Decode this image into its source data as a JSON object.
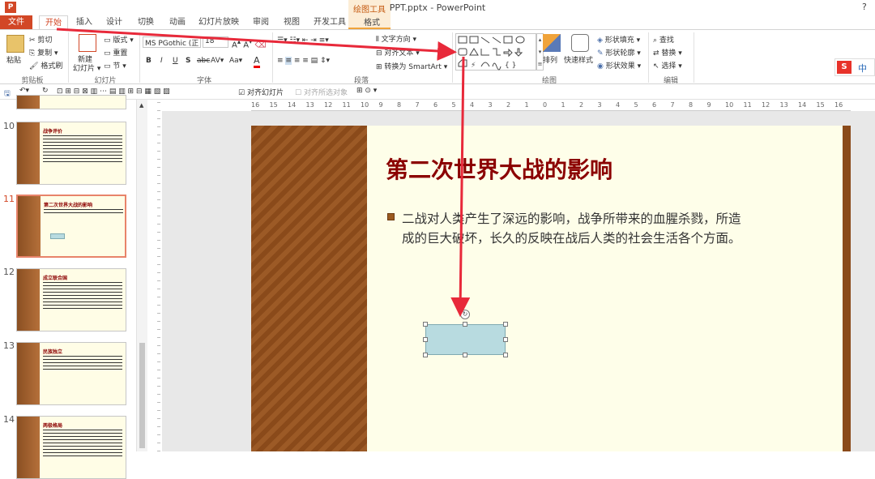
{
  "app": {
    "icon_text": "P",
    "title": "PPT.pptx - PowerPoint",
    "help": "?"
  },
  "contextual": {
    "tools_label": "绘图工具",
    "format_tab": "格式"
  },
  "tabs": [
    "文件",
    "开始",
    "插入",
    "设计",
    "切换",
    "动画",
    "幻灯片放映",
    "审阅",
    "视图",
    "开发工具"
  ],
  "ribbon": {
    "clipboard": {
      "paste": "粘贴",
      "cut": "剪切",
      "copy": "复制",
      "format_painter": "格式刷",
      "label": "剪贴板"
    },
    "slides": {
      "new_slide_1": "新建",
      "new_slide_2": "幻灯片",
      "layout": "版式",
      "reset": "重置",
      "section": "节",
      "label": "幻灯片"
    },
    "font": {
      "name": "MS PGothic (正",
      "size": "18",
      "bold": "B",
      "italic": "I",
      "underline": "U",
      "shadow": "S",
      "strike": "abc",
      "spacing": "AV",
      "case": "Aa",
      "color": "A",
      "label": "字体"
    },
    "paragraph": {
      "text_direction": "文字方向",
      "align_text": "对齐文本",
      "smartart": "转换为 SmartArt",
      "label": "段落"
    },
    "drawing": {
      "arrange": "排列",
      "quick_styles": "快速样式",
      "fill": "形状填充",
      "outline": "形状轮廓",
      "effects": "形状效果",
      "label": "绘图"
    },
    "editing": {
      "find": "查找",
      "replace": "替换",
      "select": "选择",
      "label": "编辑"
    }
  },
  "qat": {
    "align_slide": "对齐幻灯片",
    "align_selected": "对齐所选对象"
  },
  "ruler": {
    "ticks": [
      "16",
      "15",
      "14",
      "13",
      "12",
      "11",
      "10",
      "9",
      "8",
      "7",
      "6",
      "5",
      "4",
      "3",
      "2",
      "1",
      "0",
      "1",
      "2",
      "3",
      "4",
      "5",
      "6",
      "7",
      "8",
      "9",
      "10",
      "11",
      "12",
      "13",
      "14",
      "15",
      "16"
    ]
  },
  "thumbnails": [
    {
      "num": "10",
      "title": "战争评价"
    },
    {
      "num": "11",
      "title": "第二次世界大战的影响"
    },
    {
      "num": "12",
      "title": "成立联合国"
    },
    {
      "num": "13",
      "title": "民族独立"
    },
    {
      "num": "14",
      "title": "两极格局"
    }
  ],
  "slide": {
    "title": "第二次世界大战的影响",
    "body_line1": "二战对人类产生了深远的影响，战争所带来的血腥杀戮，所造",
    "body_line2": "成的巨大破坏，长久的反映在战后人类的社会生活各个方面。"
  },
  "ime": {
    "label": "中"
  },
  "colors": {
    "accent": "#d24726",
    "title": "#8b0000",
    "annotation": "#e8293a",
    "shape_fill": "#b8dbe0"
  }
}
